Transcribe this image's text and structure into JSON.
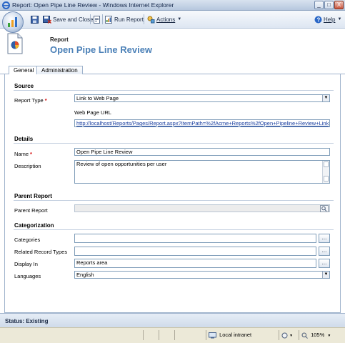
{
  "window": {
    "title": "Report: Open Pipe Line Review - Windows Internet Explorer",
    "buttons": {
      "minimize": "_",
      "maximize": "□",
      "close": "X"
    }
  },
  "toolbar": {
    "save_label": "",
    "save_close_label": "Save and Close",
    "run_report_label": "Run Report",
    "actions_label": "Actions",
    "help_label": "Help"
  },
  "header": {
    "entity_label": "Report",
    "record_title": "Open Pipe Line Review"
  },
  "tabs": [
    {
      "label": "General",
      "active": true
    },
    {
      "label": "Administration",
      "active": false
    }
  ],
  "form": {
    "source": {
      "heading": "Source",
      "report_type_label": "Report Type",
      "report_type_value": "Link to Web Page",
      "web_page_url_label": "Web Page URL",
      "web_page_url_value": "http://localhost/Reports/Pages/Report.aspx?ItemPath=%2fAcme+Reports%2fOpen+Pipeline+Review+Link"
    },
    "details": {
      "heading": "Details",
      "name_label": "Name",
      "name_value": "Open Pipe Line Review",
      "description_label": "Description",
      "description_value": "Review of open opportunities per user"
    },
    "parent_report": {
      "heading": "Parent Report",
      "parent_report_label": "Parent Report",
      "parent_report_value": ""
    },
    "categorization": {
      "heading": "Categorization",
      "categories_label": "Categories",
      "categories_value": "",
      "related_record_types_label": "Related Record Types",
      "related_record_types_value": "",
      "display_in_label": "Display In",
      "display_in_value": "Reports area",
      "languages_label": "Languages",
      "languages_value": "English",
      "ellipsis": "..."
    },
    "required_marker": "*"
  },
  "status": {
    "record_status": "Status: Existing",
    "zone": "Local intranet",
    "zoom": "105%"
  },
  "colors": {
    "title_accent": "#4d82b8",
    "required": "#d40000",
    "link": "#1a3fa0"
  }
}
